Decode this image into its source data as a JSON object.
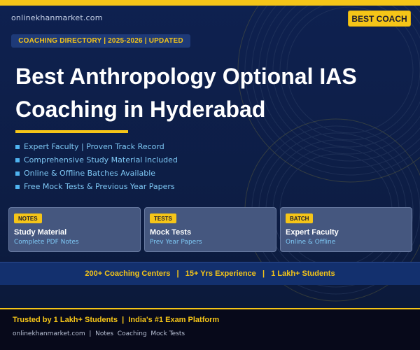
{
  "header": {
    "site": "onlinekhanmarket.com",
    "badge": "BEST COACH",
    "tag": "COACHING DIRECTORY  |  2025-2026  |  UPDATED"
  },
  "title": {
    "line1": "Best Anthropology Optional IAS",
    "line2": "Coaching in Hyderabad"
  },
  "features": [
    "Expert Faculty  |  Proven Track Record",
    "Comprehensive Study Material Included",
    "Online & Offline Batches Available",
    "Free Mock Tests & Previous Year Papers"
  ],
  "cards": [
    {
      "tag": "NOTES",
      "title": "Study Material",
      "subtitle": "Complete PDF Notes"
    },
    {
      "tag": "TESTS",
      "title": "Mock Tests",
      "subtitle": "Prev Year Papers"
    },
    {
      "tag": "BATCH",
      "title": "Expert Faculty",
      "subtitle": "Online & Offline"
    }
  ],
  "stats": "200+ Coaching Centers   |   15+ Yrs Experience   |   1 Lakh+ Students",
  "footer": {
    "trusted": "Trusted by 1 Lakh+ Students  |  India's #1 Exam Platform",
    "links": "onlinekhanmarket.com  |  Notes  Coaching  Mock Tests"
  },
  "colors": {
    "accent": "#f5c518",
    "background": "#0e2150",
    "link": "#7ec8f5"
  }
}
